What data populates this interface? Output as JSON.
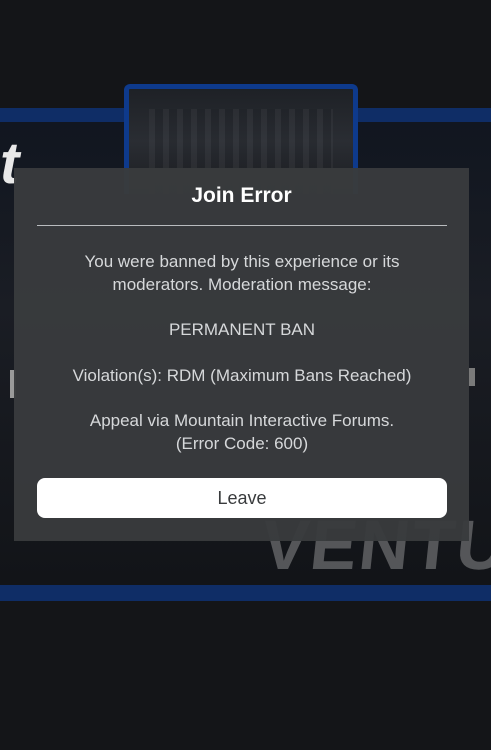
{
  "dialog": {
    "title": "Join Error",
    "message_intro": "You were banned by this experience or its moderators. Moderation message:",
    "moderation_message": "PERMANENT BAN",
    "violations": "Violation(s): RDM (Maximum Bans Reached)",
    "appeal_line": "Appeal via Mountain Interactive Forums.",
    "error_code": "(Error Code: 600)",
    "leave_label": "Leave"
  },
  "background": {
    "letter": "t",
    "word": "VENTU"
  },
  "colors": {
    "modal_bg": "#393b3d",
    "button_bg": "#ffffff",
    "title_text": "#ffffff",
    "body_text": "#d6d8da",
    "accent_blue": "#0f2d66"
  }
}
